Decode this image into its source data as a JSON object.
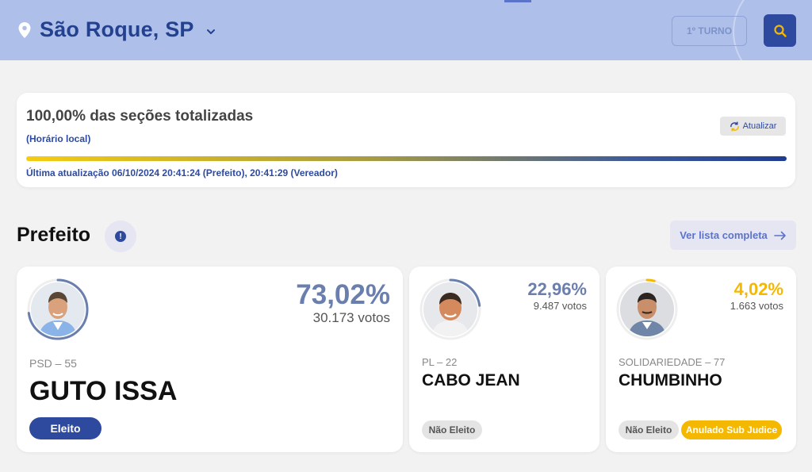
{
  "header": {
    "city": "São Roque, SP",
    "turno_label": "1º TURNO"
  },
  "status": {
    "title": "100,00% das seções totalizadas",
    "local_time_note": "(Horário local)",
    "refresh_label": "Atualizar",
    "progress": 1.0,
    "last_update": "Última atualização 06/10/2024 20:41:24 (Prefeito), 20:41:29 (Vereador)"
  },
  "section": {
    "title": "Prefeito",
    "full_list_label": "Ver lista completa"
  },
  "colors": {
    "header_bg": "#aec0ea",
    "primary": "#2e4a9e",
    "elected_pct": "#6b7fae",
    "second_pct": "#6b7fae",
    "third_pct": "#f5b800",
    "annulled": "#f5b800"
  },
  "candidates": [
    {
      "party": "PSD – 55",
      "name": "GUTO ISSA",
      "pct": "73,02%",
      "share": 0.7302,
      "votes": "30.173 votos",
      "status": "Eleito",
      "extra_status": ""
    },
    {
      "party": "PL – 22",
      "name": "CABO JEAN",
      "pct": "22,96%",
      "share": 0.2296,
      "votes": "9.487 votos",
      "status": "Não Eleito",
      "extra_status": ""
    },
    {
      "party": "SOLIDARIEDADE – 77",
      "name": "CHUMBINHO",
      "pct": "4,02%",
      "share": 0.0402,
      "votes": "1.663 votos",
      "status": "Não Eleito",
      "extra_status": "Anulado Sub Judice"
    }
  ]
}
